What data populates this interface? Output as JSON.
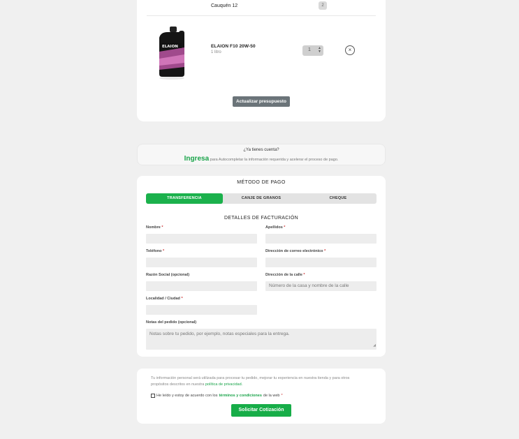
{
  "cart": {
    "previous_item_name": "Cauquén 12",
    "previous_item_qty": "2",
    "item": {
      "name": "ELAION F10 20W-50",
      "size": "1 litro",
      "quantity": "1",
      "image_icon": "oil-bottle-icon",
      "brand_label": "ELAION"
    },
    "remove_icon": "close-icon",
    "update_label": "Actualizar presupuesto"
  },
  "login": {
    "question": "¿Ya tienes cuenta?",
    "link_label": "Ingresa",
    "description": "para Autocompletar la información requerida y acelerar el proceso de pago."
  },
  "payment": {
    "title": "MÉTODO DE PAGO",
    "tabs": [
      "TRANSFERENCIA",
      "CANJE DE GRANOS",
      "CHEQUE"
    ],
    "active_tab": "TRANSFERENCIA"
  },
  "billing": {
    "title": "DETALLES DE FACTURACIÓN",
    "fields": {
      "nombre": "Nombre",
      "apellidos": "Apellidos",
      "telefono": "Teléfono",
      "email": "Dirección de correo electrónico",
      "razon_social": "Razón Social (opcional)",
      "direccion": "Dirección de la calle",
      "localidad": "Localidad / Ciudad",
      "notas": "Notas del pedido (opcional)"
    },
    "required_mark": "*",
    "direccion_placeholder": "Número de la casa y nombre de la calle",
    "notas_placeholder": "Notas sobre tu pedido, por ejemplo, notas especiales para la entrega."
  },
  "submit": {
    "privacy_text": "Tu información personal será utilizada para procesar tu pedido, mejorar tu experiencia en nuestra tienda y para otros propósitos descritos en nuestra",
    "privacy_link": "política de privacidad.",
    "terms_prefix": "He leído y estoy de acuerdo con los",
    "terms_link": "términos y condiciones",
    "terms_suffix": "de la web",
    "required_mark": "*",
    "button_label": "Solicitar Cotización"
  },
  "colors": {
    "accent": "#1bb14c",
    "button_gray": "#6b7479",
    "background": "#f0f0f0"
  }
}
